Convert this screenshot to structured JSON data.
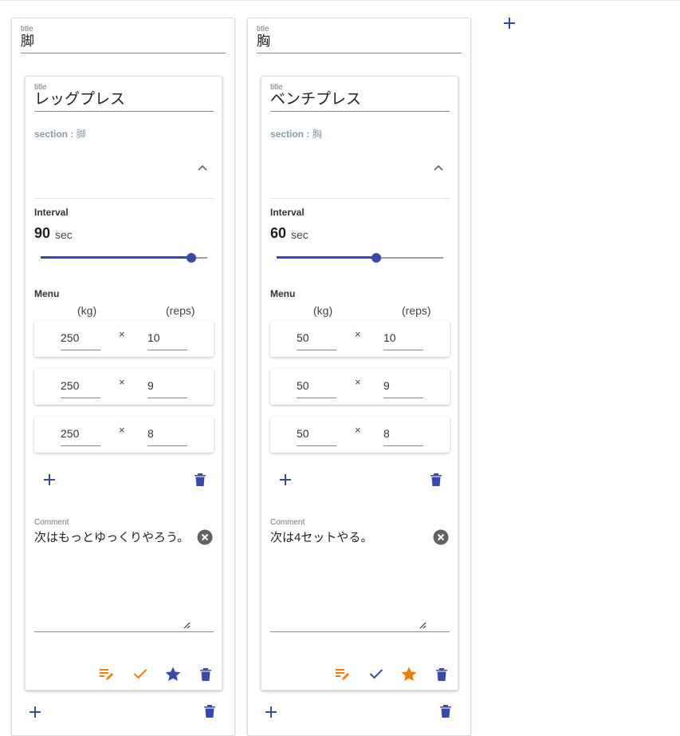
{
  "title_label": "title",
  "sections": [
    {
      "title": "脚",
      "exercise": {
        "title": "レッグプレス",
        "section_key": "section : ",
        "section_value": "脚",
        "interval_label": "Interval",
        "interval_value": "90",
        "interval_unit": "sec",
        "interval_fraction": 0.903,
        "menu_label": "Menu",
        "unit_kg": "(kg)",
        "unit_reps": "(reps)",
        "times_sign": "×",
        "sets": [
          {
            "kg": "250",
            "reps": "10"
          },
          {
            "kg": "250",
            "reps": "9"
          },
          {
            "kg": "250",
            "reps": "8"
          }
        ],
        "comment_label": "Comment",
        "comment": "次はもっとゆっくりやろう。",
        "check_color": "#f57c00",
        "star_color": "#3949ab"
      }
    },
    {
      "title": "胸",
      "exercise": {
        "title": "ベンチプレス",
        "section_key": "section : ",
        "section_value": "胸",
        "interval_label": "Interval",
        "interval_value": "60",
        "interval_unit": "sec",
        "interval_fraction": 0.6,
        "menu_label": "Menu",
        "unit_kg": "(kg)",
        "unit_reps": "(reps)",
        "times_sign": "×",
        "sets": [
          {
            "kg": "50",
            "reps": "10"
          },
          {
            "kg": "50",
            "reps": "9"
          },
          {
            "kg": "50",
            "reps": "8"
          }
        ],
        "comment_label": "Comment",
        "comment": "次は4セットやる。",
        "check_color": "#3949ab",
        "star_color": "#f57c00"
      }
    }
  ],
  "icons": {
    "add": "plus-icon",
    "delete": "trash-icon",
    "expand": "chevron-up-icon",
    "clear": "close-circle-icon",
    "edit": "playlist-edit-icon",
    "done": "check-icon",
    "favorite": "star-icon"
  },
  "colors": {
    "primary": "#3949ab",
    "accent": "#f57c00",
    "muted": "#757575"
  }
}
